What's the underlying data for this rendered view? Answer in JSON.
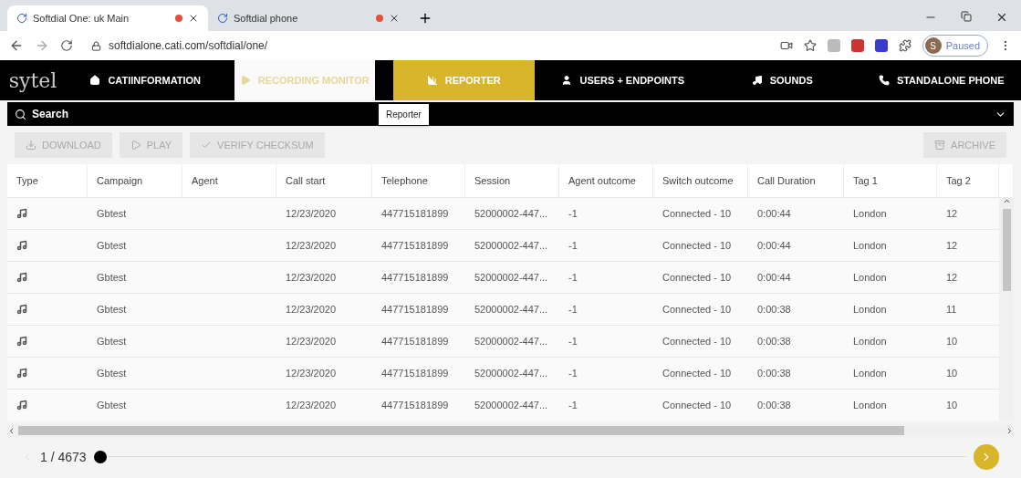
{
  "browser": {
    "tabs": [
      {
        "title": "Softdial One: uk Main",
        "selected": true
      },
      {
        "title": "Softdial phone",
        "selected": false
      }
    ],
    "url": "softdialone.cati.com/softdial/one/",
    "profile": {
      "initial": "S",
      "status": "Paused"
    }
  },
  "nav": {
    "logo": "sytel",
    "items": [
      {
        "label": "CATIINFORMATION",
        "selected": false,
        "hovered": false
      },
      {
        "label": "RECORDING MONITOR",
        "selected": true,
        "hovered": false
      },
      {
        "label": "REPORTER",
        "selected": false,
        "hovered": true
      },
      {
        "label": "USERS + ENDPOINTS",
        "selected": false,
        "hovered": false
      },
      {
        "label": "SOUNDS",
        "selected": false,
        "hovered": false
      },
      {
        "label": "STANDALONE PHONE",
        "selected": false,
        "hovered": false
      }
    ],
    "tooltip": "Reporter"
  },
  "search": {
    "label": "Search"
  },
  "toolbar": {
    "buttons": [
      {
        "label": "DOWNLOAD",
        "disabled": true
      },
      {
        "label": "PLAY",
        "disabled": true
      },
      {
        "label": "VERIFY CHECKSUM",
        "disabled": true
      }
    ],
    "archive": {
      "label": "ARCHIVE",
      "disabled": true
    }
  },
  "table": {
    "columns": [
      "Type",
      "Campaign",
      "Agent",
      "Call start",
      "Telephone",
      "Session",
      "Agent outcome",
      "Switch outcome",
      "Call Duration",
      "Tag 1",
      "Tag 2"
    ],
    "rows": [
      [
        "",
        "Gbtest",
        "",
        "12/23/2020",
        "447715181899",
        "52000002-447...",
        "-1",
        "Connected - 10",
        "0:00:44",
        "London",
        "12"
      ],
      [
        "",
        "Gbtest",
        "",
        "12/23/2020",
        "447715181899",
        "52000002-447...",
        "-1",
        "Connected - 10",
        "0:00:44",
        "London",
        "12"
      ],
      [
        "",
        "Gbtest",
        "",
        "12/23/2020",
        "447715181899",
        "52000002-447...",
        "-1",
        "Connected - 10",
        "0:00:44",
        "London",
        "12"
      ],
      [
        "",
        "Gbtest",
        "",
        "12/23/2020",
        "447715181899",
        "52000002-447...",
        "-1",
        "Connected - 10",
        "0:00:38",
        "London",
        "11"
      ],
      [
        "",
        "Gbtest",
        "",
        "12/23/2020",
        "447715181899",
        "52000002-447...",
        "-1",
        "Connected - 10",
        "0:00:38",
        "London",
        "10"
      ],
      [
        "",
        "Gbtest",
        "",
        "12/23/2020",
        "447715181899",
        "52000002-447...",
        "-1",
        "Connected - 10",
        "0:00:38",
        "London",
        "10"
      ],
      [
        "",
        "Gbtest",
        "",
        "12/23/2020",
        "447715181899",
        "52000002-447...",
        "-1",
        "Connected - 10",
        "0:00:38",
        "London",
        "10"
      ]
    ]
  },
  "pager": {
    "page": "1 / 4673",
    "level": 0
  }
}
